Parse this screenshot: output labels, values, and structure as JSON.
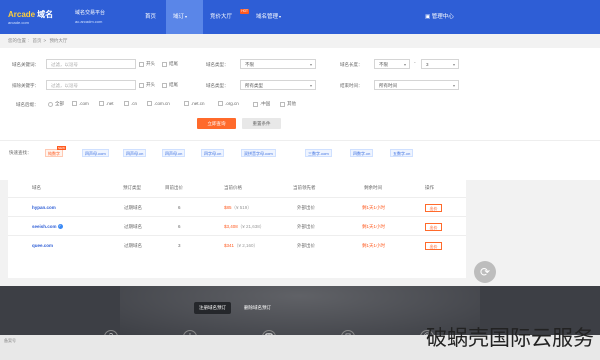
{
  "header": {
    "logo_brand": "Arcade",
    "logo_text": "域名",
    "logo_url": "arcade.com",
    "tagline_1": "域名交易平台",
    "tagline_2": "ac.arcadm.com",
    "nav": [
      {
        "label": "首页"
      },
      {
        "label": "域订",
        "caret": "▾"
      },
      {
        "label": "竞价大厅",
        "hot": "HOT"
      },
      {
        "label": "域名管理",
        "caret": "▾"
      }
    ],
    "user_center": "管理中心"
  },
  "breadcrumb": [
    "您的位置",
    "首页",
    "预约大厅"
  ],
  "filter": {
    "kw_label": "域名关键词：",
    "kw_placeholder": "过滤，以逗号",
    "kw_start": "开头",
    "kw_end": "结尾",
    "ex_label": "排除关键字：",
    "ex_placeholder": "过滤，以逗号",
    "ex_start": "开头",
    "ex_end": "结尾",
    "type_label": "域名类型：",
    "type_value": "不限",
    "type2_label": "域名类型：",
    "type2_value": "所有类型",
    "len_label": "域名长度：",
    "len_from": "不限",
    "len_to": "3",
    "end_label": "结束时间：",
    "end_value": "所有时间",
    "suffix_label": "域名后缀：",
    "suffixes": [
      "全部",
      ".com",
      ".net",
      ".cn",
      ".com.cn",
      ".net.cn",
      ".org.cn",
      ".中国",
      "其他"
    ],
    "search_btn": "立即查询",
    "reset_btn": "重置条件"
  },
  "quick": {
    "label": "快速查找：",
    "tags": [
      "纯数字",
      "四声母.com",
      "四声母.cn",
      "四声母.cn",
      "四字母.cn",
      "双拼音字母.com",
      "三数字.com",
      "四数字.cn",
      "五数字.cn"
    ],
    "new_badge": "NEW"
  },
  "table": {
    "headers": [
      "域名",
      "预订类型",
      "目前出价",
      "当前价格",
      "当前领先者",
      "剩余时间",
      "操作"
    ],
    "rows": [
      {
        "domain": "hypan.com",
        "verified": false,
        "type": "过期域名",
        "bids": "6",
        "price": "$85",
        "cny": "（¥ 519）",
        "leader": "外部出价",
        "end": "剩1天1小时",
        "op": "出价"
      },
      {
        "domain": "seeish.com",
        "verified": true,
        "type": "过期域名",
        "bids": "6",
        "price": "$3,408",
        "cny": "（¥ 21,638）",
        "leader": "外部出价",
        "end": "剩1天1小时",
        "op": "出价"
      },
      {
        "domain": "quee.com",
        "verified": false,
        "type": "过期域名",
        "bids": "3",
        "price": "$341",
        "cny": "（¥ 2,160）",
        "leader": "外部出价",
        "end": "剩1天1小时",
        "op": "出价"
      }
    ]
  },
  "float_icon": "refresh-icon",
  "bottom": {
    "tab_active": "注册域名预订",
    "tab_other": "删除域名预订",
    "icons": [
      "help-icon",
      "notice-icon",
      "phone-icon",
      "chat-icon",
      "mail-icon"
    ],
    "strip_text": "备案号",
    "watermark": "破蜗壳国际云服务"
  }
}
